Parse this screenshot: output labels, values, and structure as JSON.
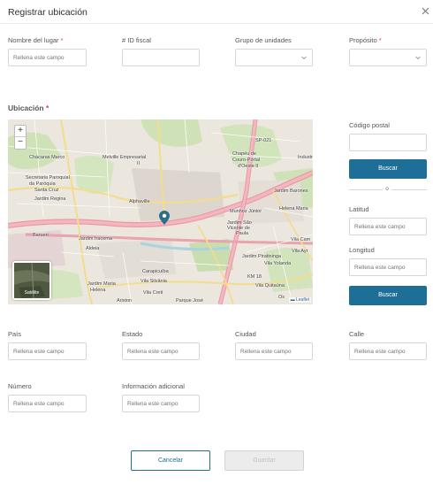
{
  "dialog": {
    "title": "Registrar ubicación"
  },
  "placeholder": "Rellena este campo",
  "required_mark": "*",
  "fields": {
    "nombre": {
      "label": "Nombre del lugar"
    },
    "id_fiscal": {
      "label": "# ID fiscal"
    },
    "grupo": {
      "label": "Grupo de unidades"
    },
    "proposito": {
      "label": "Propósito"
    },
    "codigo_postal": {
      "label": "Código postal"
    },
    "latitud": {
      "label": "Latitud"
    },
    "longitud": {
      "label": "Longitud"
    },
    "pais": {
      "label": "País"
    },
    "estado": {
      "label": "Estado"
    },
    "ciudad": {
      "label": "Ciudad"
    },
    "calle": {
      "label": "Calle"
    },
    "numero": {
      "label": "Número"
    },
    "info": {
      "label": "Información adicional"
    }
  },
  "location": {
    "title": "Ubicación",
    "or_text": "o",
    "search_label": "Buscar"
  },
  "map": {
    "zoom_in": "+",
    "zoom_out": "−",
    "satellite_label": "Satélite",
    "attribution": "Leaflet",
    "labels": {
      "l1": "Chácaras Marco",
      "l2": "Melville Empresarial",
      "l3": "II",
      "l4": "Secretaria Paroquial",
      "l5": "da Paróquia",
      "l6": "Santa Cruz",
      "l7": "Jardim Regina",
      "l8": "Alphaville",
      "l9": "Barueri",
      "l10": "Jardim Iracema",
      "l11": "Aldeia",
      "l12": "Carapicuíba",
      "l13": "Jardim Maria",
      "l14": "Helena",
      "l15": "Vila Silvânia",
      "l16": "Vila Creti",
      "l17": "Ariston",
      "l18": "Parque José",
      "l19": "Chapéu de",
      "l20": "Couro-Portal",
      "l21": "d'Oeste II",
      "l22": "Munhoz Júnior",
      "l23": "Jardim São",
      "l24": "Vicente de",
      "l25": "Paula",
      "l26": "Jardim Barones",
      "l27": "Helena Maria",
      "l28": "Jardim Piratininga",
      "l29": "Vila Yolanda",
      "l30": "KM 18",
      "l31": "Vila Quitaúna",
      "l32": "Industr",
      "l33": "SP-021",
      "l34": "Os",
      "l35": "Vila Cam",
      "l36": "Vila Ayr"
    }
  },
  "actions": {
    "cancel_label": "Cancelar",
    "save_label": "Guardar"
  },
  "colors": {
    "accent": "#1e6f97",
    "required": "#d64545",
    "marker": "#2a6f8c"
  }
}
